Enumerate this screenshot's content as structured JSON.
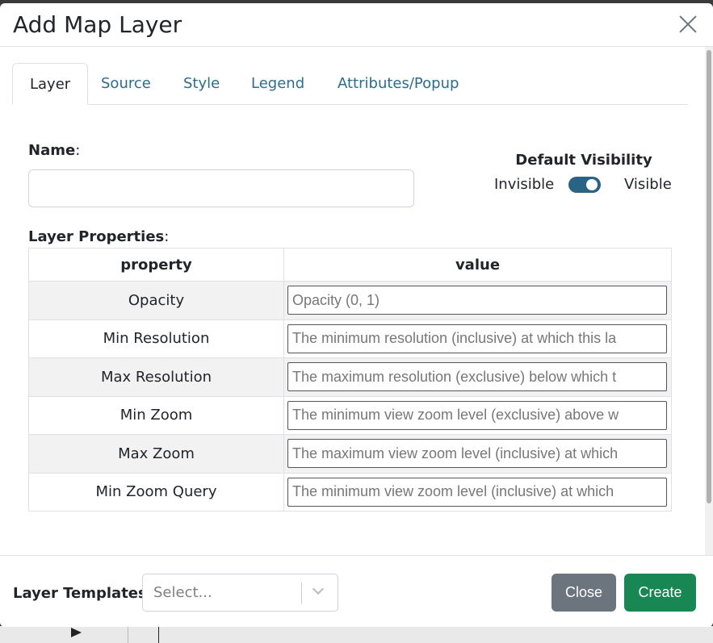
{
  "modal": {
    "title": "Add Map Layer"
  },
  "tabs": [
    {
      "label": "Layer",
      "active": true
    },
    {
      "label": "Source",
      "active": false
    },
    {
      "label": "Style",
      "active": false
    },
    {
      "label": "Legend",
      "active": false
    },
    {
      "label": "Attributes/Popup",
      "active": false
    }
  ],
  "name_field": {
    "label": "Name",
    "suffix": ":",
    "value": ""
  },
  "visibility": {
    "title": "Default Visibility",
    "off_label": "Invisible",
    "on_label": "Visible",
    "checked": true
  },
  "layer_properties": {
    "label": "Layer Properties",
    "suffix": ":",
    "columns": [
      "property",
      "value"
    ],
    "rows": [
      {
        "property": "Opacity",
        "placeholder": "Opacity (0, 1)"
      },
      {
        "property": "Min Resolution",
        "placeholder": "The minimum resolution (inclusive) at which this la"
      },
      {
        "property": "Max Resolution",
        "placeholder": "The maximum resolution (exclusive) below which t"
      },
      {
        "property": "Min Zoom",
        "placeholder": "The minimum view zoom level (exclusive) above w"
      },
      {
        "property": "Max Zoom",
        "placeholder": "The maximum view zoom level (inclusive) at which"
      },
      {
        "property": "Min Zoom Query",
        "placeholder": "The minimum view zoom level (inclusive) at which"
      }
    ]
  },
  "footer": {
    "templates_label": "Layer Templates",
    "select_placeholder": "Select...",
    "close_label": "Close",
    "create_label": "Create"
  },
  "colors": {
    "tab_link": "#2b6c8e",
    "toggle_on": "#2a6485",
    "close_button": "#6c757d",
    "create_button": "#198754"
  }
}
